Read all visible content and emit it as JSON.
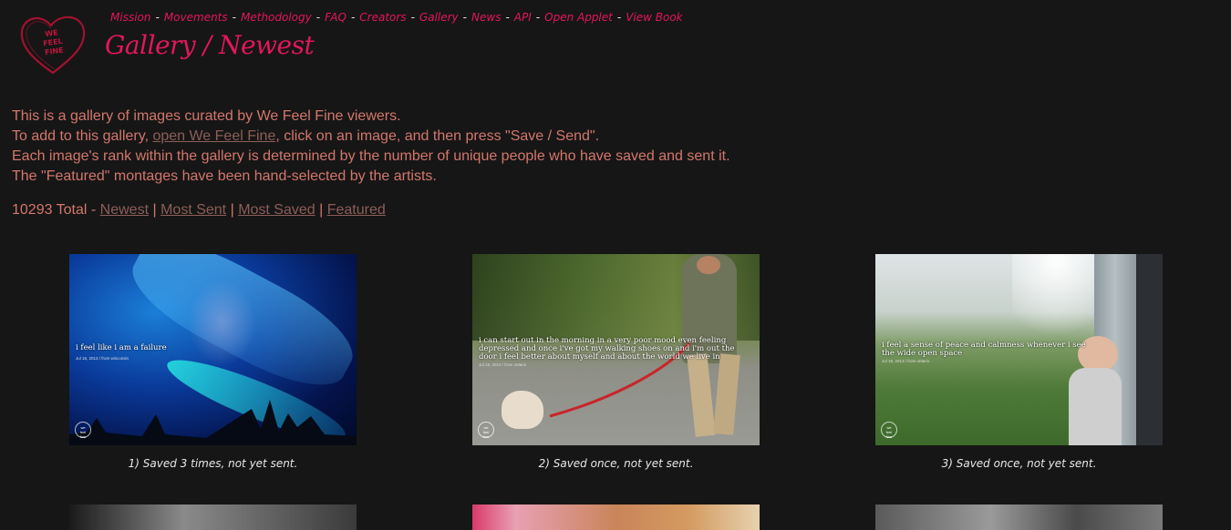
{
  "logo": {
    "lines": [
      "WE",
      "FEEL",
      "FINE"
    ],
    "icon": "heart-logo-icon"
  },
  "nav": [
    "Mission",
    "Movements",
    "Methodology",
    "FAQ",
    "Creators",
    "Gallery",
    "News",
    "API",
    "Open Applet",
    "View Book"
  ],
  "title": "Gallery / Newest",
  "intro": {
    "line1": "This is a gallery of images curated by We Feel Fine viewers.",
    "line2_before": "To add to this gallery, ",
    "line2_link": "open We Feel Fine",
    "line2_after": ", click on an image, and then press \"Save / Send\".",
    "line3": "Each image's rank within the gallery is determined by the number of unique people who have saved and sent it.",
    "line4": "The \"Featured\" montages have been hand-selected by the artists."
  },
  "totals": {
    "count_text": "10293 Total - ",
    "links": [
      "Newest",
      "Most Sent",
      "Most Saved",
      "Featured"
    ],
    "separator": "|"
  },
  "gallery": [
    {
      "quote": "i feel like i am a failure",
      "meta": "Jul 18, 2013 / from wisconsin",
      "caption": "1) Saved 3 times, not yet sent."
    },
    {
      "quote": "i can start out in the morning in a very poor mood even feeling depressed and once i've got my walking shoes on and i'm out the door i feel better about myself and about the world we live in",
      "meta": "Jul 18, 2013 / from ontario",
      "caption": "2) Saved once, not yet sent."
    },
    {
      "quote": "i feel a sense of peace and calmness whenever i see the wide open space",
      "meta": "Jul 18, 2013 / from ontario",
      "caption": "3) Saved once, not yet sent."
    }
  ],
  "colors": {
    "background": "#161616",
    "accent": "#e3165b",
    "body_text": "#d3776b",
    "link": "#8c5e58"
  }
}
